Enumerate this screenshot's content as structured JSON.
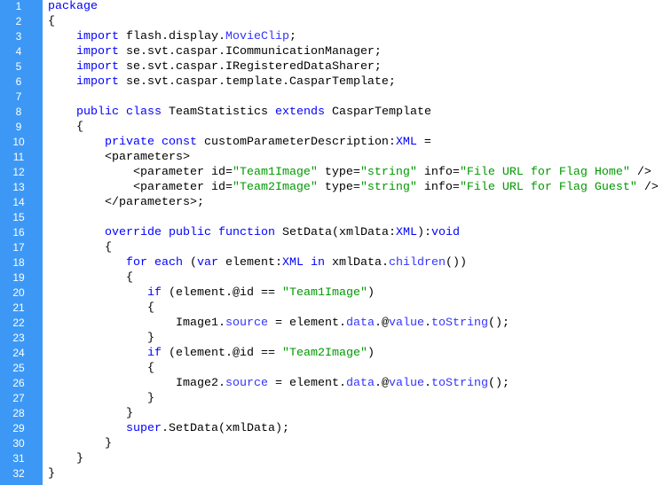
{
  "colors": {
    "gutter": "#3d98f5",
    "keyword": "#0000ff",
    "member": "#3333ff",
    "string": "#009900",
    "text": "#000000"
  },
  "lines": [
    [
      [
        "kw",
        "package"
      ]
    ],
    [
      [
        "tx",
        "{"
      ]
    ],
    [
      [
        "tx",
        "    "
      ],
      [
        "kw",
        "import"
      ],
      [
        "tx",
        " flash.display."
      ],
      [
        "mb",
        "MovieClip"
      ],
      [
        "tx",
        ";"
      ]
    ],
    [
      [
        "tx",
        "    "
      ],
      [
        "kw",
        "import"
      ],
      [
        "tx",
        " se.svt.caspar.ICommunicationManager;"
      ]
    ],
    [
      [
        "tx",
        "    "
      ],
      [
        "kw",
        "import"
      ],
      [
        "tx",
        " se.svt.caspar.IRegisteredDataSharer;"
      ]
    ],
    [
      [
        "tx",
        "    "
      ],
      [
        "kw",
        "import"
      ],
      [
        "tx",
        " se.svt.caspar.template.CasparTemplate;"
      ]
    ],
    [],
    [
      [
        "tx",
        "    "
      ],
      [
        "kw",
        "public class"
      ],
      [
        "tx",
        " TeamStatistics "
      ],
      [
        "kw",
        "extends"
      ],
      [
        "tx",
        " CasparTemplate"
      ]
    ],
    [
      [
        "tx",
        "    {"
      ]
    ],
    [
      [
        "tx",
        "        "
      ],
      [
        "kw",
        "private const"
      ],
      [
        "tx",
        " customParameterDescription:"
      ],
      [
        "kw",
        "XML"
      ],
      [
        "tx",
        " ="
      ]
    ],
    [
      [
        "tx",
        "        <parameters>"
      ]
    ],
    [
      [
        "tx",
        "            <parameter id="
      ],
      [
        "st",
        "\"Team1Image\""
      ],
      [
        "tx",
        " type="
      ],
      [
        "st",
        "\"string\""
      ],
      [
        "tx",
        " info="
      ],
      [
        "st",
        "\"File URL for Flag Home\""
      ],
      [
        "tx",
        " />"
      ]
    ],
    [
      [
        "tx",
        "            <parameter id="
      ],
      [
        "st",
        "\"Team2Image\""
      ],
      [
        "tx",
        " type="
      ],
      [
        "st",
        "\"string\""
      ],
      [
        "tx",
        " info="
      ],
      [
        "st",
        "\"File URL for Flag Guest\""
      ],
      [
        "tx",
        " />"
      ]
    ],
    [
      [
        "tx",
        "        </parameters>;"
      ]
    ],
    [],
    [
      [
        "tx",
        "        "
      ],
      [
        "kw",
        "override public function"
      ],
      [
        "tx",
        " SetData(xmlData:"
      ],
      [
        "kw",
        "XML"
      ],
      [
        "tx",
        "):"
      ],
      [
        "kw",
        "void"
      ]
    ],
    [
      [
        "tx",
        "        {"
      ]
    ],
    [
      [
        "tx",
        "           "
      ],
      [
        "kw",
        "for each"
      ],
      [
        "tx",
        " ("
      ],
      [
        "kw",
        "var"
      ],
      [
        "tx",
        " element:"
      ],
      [
        "kw",
        "XML"
      ],
      [
        "tx",
        " "
      ],
      [
        "kw",
        "in"
      ],
      [
        "tx",
        " xmlData."
      ],
      [
        "mb",
        "children"
      ],
      [
        "tx",
        "())"
      ]
    ],
    [
      [
        "tx",
        "           {"
      ]
    ],
    [
      [
        "tx",
        "              "
      ],
      [
        "kw",
        "if"
      ],
      [
        "tx",
        " (element.@id == "
      ],
      [
        "st",
        "\"Team1Image\""
      ],
      [
        "tx",
        ")"
      ]
    ],
    [
      [
        "tx",
        "              {"
      ]
    ],
    [
      [
        "tx",
        "                  Image1."
      ],
      [
        "mb",
        "source"
      ],
      [
        "tx",
        " = element."
      ],
      [
        "mb",
        "data"
      ],
      [
        "tx",
        ".@"
      ],
      [
        "mb",
        "value"
      ],
      [
        "tx",
        "."
      ],
      [
        "mb",
        "toString"
      ],
      [
        "tx",
        "();"
      ]
    ],
    [
      [
        "tx",
        "              }"
      ]
    ],
    [
      [
        "tx",
        "              "
      ],
      [
        "kw",
        "if"
      ],
      [
        "tx",
        " (element.@id == "
      ],
      [
        "st",
        "\"Team2Image\""
      ],
      [
        "tx",
        ")"
      ]
    ],
    [
      [
        "tx",
        "              {"
      ]
    ],
    [
      [
        "tx",
        "                  Image2."
      ],
      [
        "mb",
        "source"
      ],
      [
        "tx",
        " = element."
      ],
      [
        "mb",
        "data"
      ],
      [
        "tx",
        ".@"
      ],
      [
        "mb",
        "value"
      ],
      [
        "tx",
        "."
      ],
      [
        "mb",
        "toString"
      ],
      [
        "tx",
        "();"
      ]
    ],
    [
      [
        "tx",
        "              }"
      ]
    ],
    [
      [
        "tx",
        "           }"
      ]
    ],
    [
      [
        "tx",
        "           "
      ],
      [
        "kw",
        "super"
      ],
      [
        "tx",
        ".SetData(xmlData);"
      ]
    ],
    [
      [
        "tx",
        "        }"
      ]
    ],
    [
      [
        "tx",
        "    }"
      ]
    ],
    [
      [
        "tx",
        "}"
      ]
    ]
  ]
}
